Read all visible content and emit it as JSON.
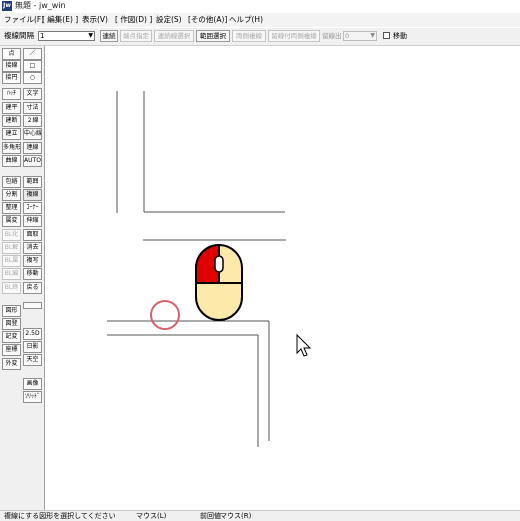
{
  "window": {
    "app_icon": "Jw",
    "title": "無題 - jw_win"
  },
  "menubar": [
    "ファイル(F)",
    "[ 編集(E) ]",
    "表示(V)",
    "[ 作図(D) ]",
    "設定(S)",
    "[その他(A)]",
    "ヘルプ(H)"
  ],
  "toolbar": {
    "mode_label": "複線間隔",
    "mode_value": "1",
    "buttons": [
      {
        "label": "連続",
        "disabled": false
      },
      {
        "label": "端点指定",
        "disabled": true
      },
      {
        "label": "連続線選択",
        "disabled": true
      },
      {
        "label": "範囲選択",
        "disabled": false
      },
      {
        "label": "両側複線",
        "disabled": true
      },
      {
        "label": "留線付両側複線",
        "disabled": true
      }
    ],
    "page_label": "留線出",
    "page_value": "0",
    "move_label": "移動",
    "move_checked": false
  },
  "tools": {
    "left": [
      "点",
      "接線",
      "接円",
      "ﾊｯﾁ",
      "建平",
      "建断",
      "建立",
      "多角形",
      "曲線",
      "包絡",
      "分割",
      "整理",
      "属変",
      "BL化",
      "BL解",
      "BL属",
      "BL編",
      "BL終",
      "図形",
      "図登",
      "記変",
      "座標",
      "外変"
    ],
    "right": [
      "／",
      "□",
      "○",
      "文字",
      "寸法",
      "２線",
      "中心線",
      "連線",
      "AUTO",
      "範囲",
      "複線",
      "ｺｰﾅｰ",
      "伸縮",
      "面取",
      "消去",
      "複写",
      "移動",
      "戻る",
      "",
      "2.5D",
      "日影",
      "天空",
      "画像",
      "ｿﾘｯﾄﾞ"
    ],
    "disabled_left": [
      "BL化",
      "BL解",
      "BL属",
      "BL編",
      "BL終"
    ]
  },
  "mouse_hint": {
    "body_color": "#fde9a9",
    "highlight_color": "#e00000"
  },
  "cursor_ring_color": "#d9606a",
  "status": {
    "message": "複線にする図形を選択してください",
    "left_button": "マウス(L)",
    "prev": "前回値",
    "right_button": "マウス(R)"
  }
}
